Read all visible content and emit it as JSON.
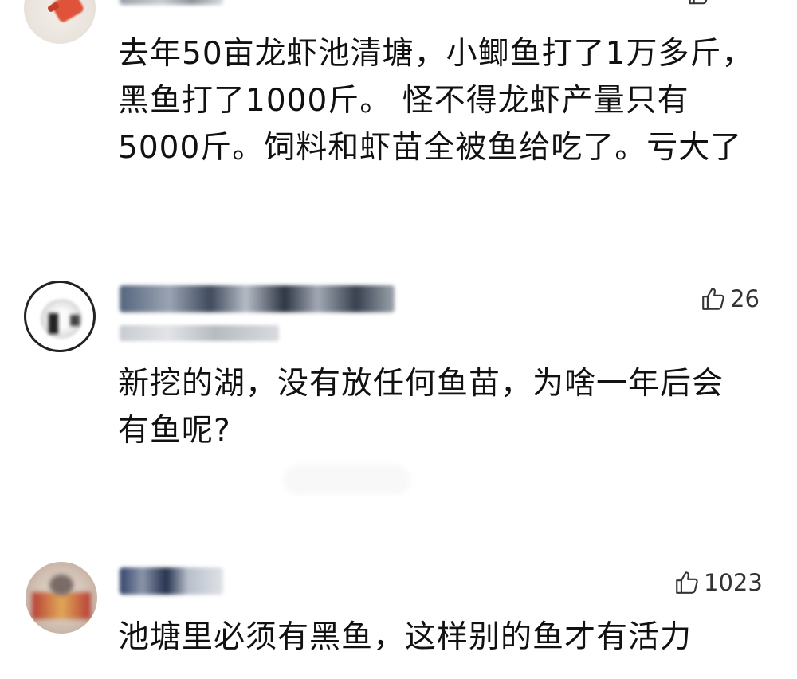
{
  "comments": [
    {
      "like_count": "",
      "text": "去年50亩龙虾池清塘，小鲫鱼打了1万多斤，黑鱼打了1000斤。 怪不得龙虾产量只有5000斤。饲料和虾苗全被鱼给吃了。亏大了",
      "lines": [
        "去年50亩龙虾池清塘，小鲫鱼打了1万多斤，",
        "黑鱼打了1000斤。 怪不得龙虾产量只有",
        "5000斤。饲料和虾苗全被鱼给吃了。亏大了"
      ]
    },
    {
      "like_count": "26",
      "text": "新挖的湖，没有放任何鱼苗，为啥一年后会有鱼呢?",
      "lines": [
        "新挖的湖，没有放任何鱼苗，为啥一年后会",
        "有鱼呢?"
      ]
    },
    {
      "like_count": "1023",
      "text": "池塘里必须有黑鱼，这样别的鱼才有活力",
      "lines": [
        "池塘里必须有黑鱼，这样别的鱼才有活力"
      ]
    }
  ],
  "icons": {
    "like": "thumbs-up-icon"
  },
  "colors": {
    "text": "#111111",
    "like": "#333333",
    "background": "#ffffff"
  }
}
